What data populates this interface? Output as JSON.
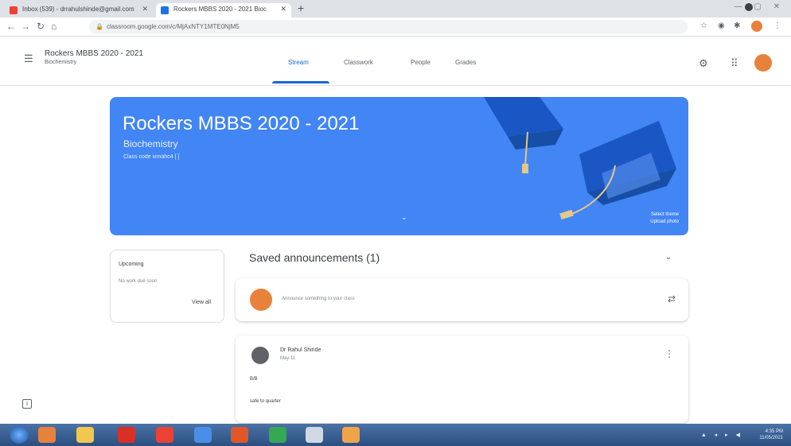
{
  "browser": {
    "tabs": [
      {
        "label": "Inbox (539) - drrahulshinde@gmail.com",
        "active": false
      },
      {
        "label": "Rockers MBBS 2020 - 2021 Bioc",
        "active": true
      }
    ],
    "new_tab_symbol": "+",
    "url": "classroom.google.com/c/MjAxNTY1MTE0NjM5",
    "window_controls": "— ▢ ✕"
  },
  "classroom": {
    "course_title": "Rockers MBBS 2020 - 2021",
    "course_subject": "Biochemistry",
    "tabs": [
      "Stream",
      "Classwork",
      "People",
      "Grades"
    ],
    "active_tab": "Stream"
  },
  "banner": {
    "title": "Rockers MBBS 2020 - 2021",
    "subtitle": "Biochemistry",
    "class_code": "Class code  ixmahc4  [ ]",
    "link_line1": "Select theme",
    "link_line2": "Upload photo",
    "color": "#4285f4"
  },
  "upcoming": {
    "title": "Upcoming",
    "note": "No work due soon",
    "view_all": "View all"
  },
  "stream": {
    "saved_heading": "Saved announcements (1)",
    "compose_placeholder": "Announce something to your class",
    "post": {
      "author": "Dr Rahul Shinde",
      "date": "May 11",
      "line1": "B/B",
      "line2": "safe to quarter"
    }
  },
  "taskbar": {
    "tray": "▲ ◂ ▸ ◀",
    "clock_time": "4:35 PM",
    "clock_date": "11/05/2021"
  },
  "colors": {
    "accent": "#1967d2",
    "banner": "#4285f4",
    "avatar": "#e8823a"
  }
}
